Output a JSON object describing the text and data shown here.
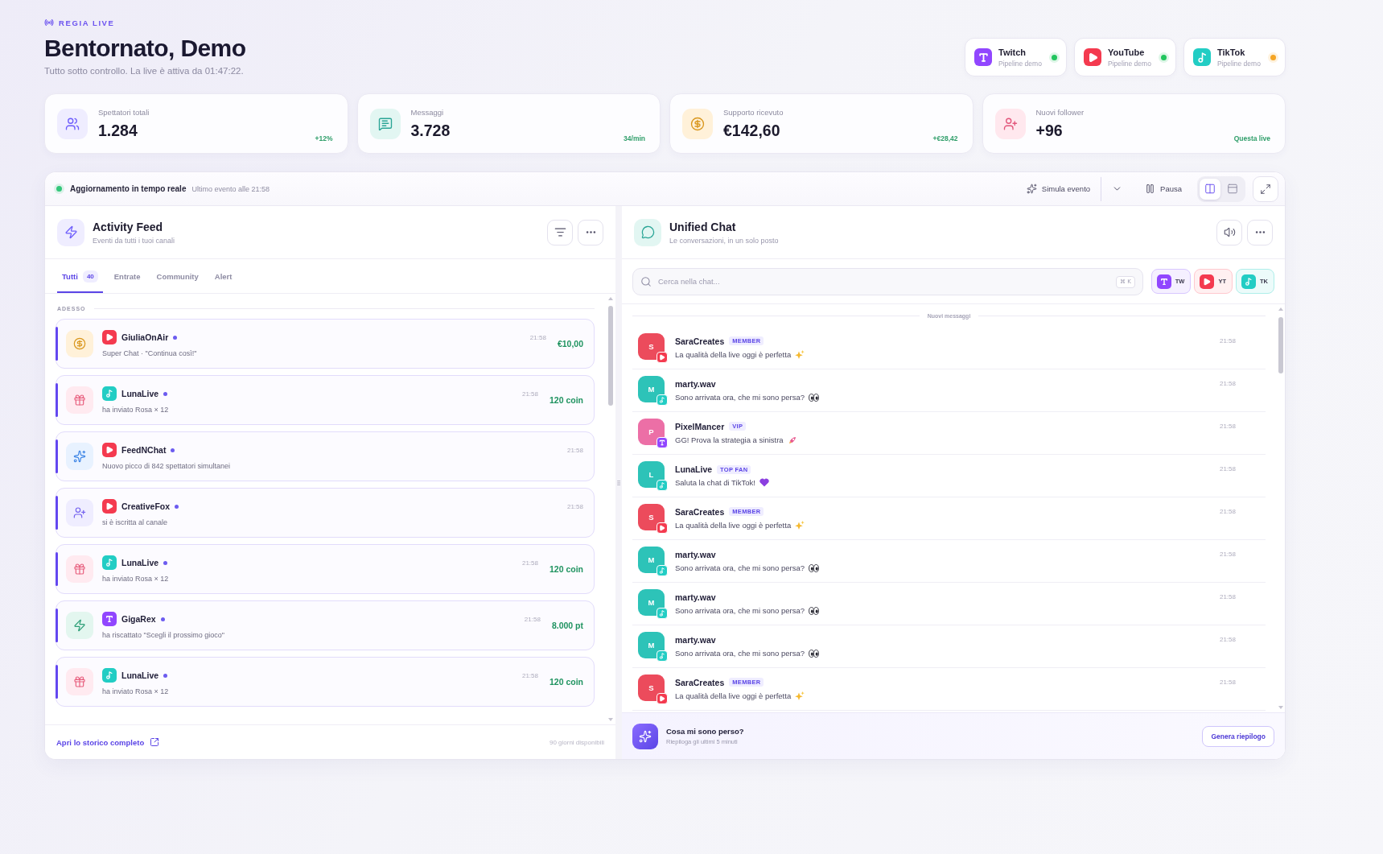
{
  "header": {
    "eyebrow": "REGIA LIVE",
    "title": "Bentornato, Demo",
    "subtitle": "Tutto sotto controllo. La live è attiva da 01:47:22."
  },
  "platforms": [
    {
      "kind": "twitch",
      "name": "Twitch",
      "status": "Pipeline demo",
      "color": "#22c55e"
    },
    {
      "kind": "youtube",
      "name": "YouTube",
      "status": "Pipeline demo",
      "color": "#22c55e"
    },
    {
      "kind": "tiktok",
      "name": "TikTok",
      "status": "Pipeline demo",
      "color": "#f5a524"
    }
  ],
  "stats": [
    {
      "kind": "viewers",
      "label": "Spettatori totali",
      "value": "1.284",
      "delta": "+12%"
    },
    {
      "kind": "messages",
      "label": "Messaggi",
      "value": "3.728",
      "delta": "34/min"
    },
    {
      "kind": "support",
      "label": "Supporto ricevuto",
      "value": "€142,60",
      "delta": "+€28,42"
    },
    {
      "kind": "followers",
      "label": "Nuovi follower",
      "value": "+96",
      "delta": "Questa live"
    }
  ],
  "toolbar": {
    "live": true,
    "status": "Aggiornamento in tempo reale",
    "last_event": "Ultimo evento alle 21:58",
    "simulate": "Simula evento",
    "pause": "Pausa",
    "views": [
      {
        "kind": "split",
        "selected": true
      },
      {
        "kind": "single",
        "selected": false
      }
    ]
  },
  "feed": {
    "title": "Activity Feed",
    "subtitle": "Eventi da tutti i tuoi canali",
    "tabs": [
      {
        "label": "Tutti",
        "count": "40",
        "selected": true
      },
      {
        "label": "Entrate",
        "selected": false
      },
      {
        "label": "Community",
        "selected": false
      },
      {
        "label": "Alert",
        "selected": false
      }
    ],
    "group": "ADESSO",
    "items": [
      {
        "kind": "support",
        "source": {
          "kind": "youtube"
        },
        "user": "GiuliaOnAir",
        "unread": true,
        "text": "Super Chat · \"Continua così!\"",
        "time": "21:58",
        "amount": "€10,00"
      },
      {
        "kind": "gift",
        "source": {
          "kind": "tiktok"
        },
        "user": "LunaLive",
        "unread": true,
        "text": "ha inviato Rosa × 12",
        "time": "21:58",
        "amount": "120 coin"
      },
      {
        "kind": "milestone",
        "source": {
          "kind": "youtube"
        },
        "user": "FeedNChat",
        "unread": true,
        "text": "Nuovo picco di 842 spettatori simultanei",
        "time": "21:58"
      },
      {
        "kind": "follow",
        "source": {
          "kind": "youtube"
        },
        "user": "CreativeFox",
        "unread": true,
        "text": "si è iscritta al canale",
        "time": "21:58"
      },
      {
        "kind": "gift",
        "source": {
          "kind": "tiktok"
        },
        "user": "LunaLive",
        "unread": true,
        "text": "ha inviato Rosa × 12",
        "time": "21:58",
        "amount": "120 coin"
      },
      {
        "kind": "redeem",
        "source": {
          "kind": "twitch"
        },
        "user": "GigaRex",
        "unread": true,
        "text": "ha riscattato \"Scegli il prossimo gioco\"",
        "time": "21:58",
        "amount": "8.000 pt"
      },
      {
        "kind": "gift",
        "source": {
          "kind": "tiktok"
        },
        "user": "LunaLive",
        "unread": true,
        "text": "ha inviato Rosa × 12",
        "time": "21:58",
        "amount": "120 coin"
      }
    ],
    "footer_link": "Apri lo storico completo",
    "footer_note": "90 giorni disponibili"
  },
  "chat": {
    "title": "Unified Chat",
    "subtitle": "Le conversazioni, in un solo posto",
    "search": {
      "placeholder": "Cerca nella chat...",
      "shortcut": "⌘ K"
    },
    "filters": [
      {
        "kind": "twitch",
        "label": "TW",
        "selected": true
      },
      {
        "kind": "youtube",
        "label": "YT",
        "selected": true
      },
      {
        "kind": "tiktok",
        "label": "TK",
        "selected": true
      }
    ],
    "divider": "Nuovi messaggi",
    "messages": [
      {
        "user": "SaraCreates",
        "initial": "S",
        "color": "#ec4b5c",
        "source": {
          "kind": "youtube"
        },
        "role": "MEMBER",
        "text": "La qualità della live oggi è perfetta",
        "emoji": {
          "kind": "sparkles"
        },
        "time": "21:58"
      },
      {
        "user": "marty.wav",
        "initial": "M",
        "color": "#2dc3b8",
        "source": {
          "kind": "tiktok"
        },
        "text": "Sono arrivata ora, che mi sono persa?",
        "emoji": {
          "kind": "eyes"
        },
        "time": "21:58"
      },
      {
        "user": "PixelMancer",
        "initial": "P",
        "color": "#ec6fa6",
        "source": {
          "kind": "twitch"
        },
        "role": "VIP",
        "text": "GG! Prova la strategia a sinistra",
        "emoji": {
          "kind": "rocket"
        },
        "time": "21:58"
      },
      {
        "user": "LunaLive",
        "initial": "L",
        "color": "#2dc3b8",
        "source": {
          "kind": "tiktok"
        },
        "role": "TOP FAN",
        "text": "Saluta la chat di TikTok!",
        "emoji": {
          "kind": "heart"
        },
        "time": "21:58"
      },
      {
        "user": "SaraCreates",
        "initial": "S",
        "color": "#ec4b5c",
        "source": {
          "kind": "youtube"
        },
        "role": "MEMBER",
        "text": "La qualità della live oggi è perfetta",
        "emoji": {
          "kind": "sparkles"
        },
        "time": "21:58"
      },
      {
        "user": "marty.wav",
        "initial": "M",
        "color": "#2dc3b8",
        "source": {
          "kind": "tiktok"
        },
        "text": "Sono arrivata ora, che mi sono persa?",
        "emoji": {
          "kind": "eyes"
        },
        "time": "21:58"
      },
      {
        "user": "marty.wav",
        "initial": "M",
        "color": "#2dc3b8",
        "source": {
          "kind": "tiktok"
        },
        "text": "Sono arrivata ora, che mi sono persa?",
        "emoji": {
          "kind": "eyes"
        },
        "time": "21:58"
      },
      {
        "user": "marty.wav",
        "initial": "M",
        "color": "#2dc3b8",
        "source": {
          "kind": "tiktok"
        },
        "text": "Sono arrivata ora, che mi sono persa?",
        "emoji": {
          "kind": "eyes"
        },
        "time": "21:58"
      },
      {
        "user": "SaraCreates",
        "initial": "S",
        "color": "#ec4b5c",
        "source": {
          "kind": "youtube"
        },
        "role": "MEMBER",
        "text": "La qualità della live oggi è perfetta",
        "emoji": {
          "kind": "sparkles"
        },
        "time": "21:58"
      }
    ],
    "summary": {
      "title": "Cosa mi sono perso?",
      "subtitle": "Riepiloga gli ultimi 5 minuti",
      "button": "Genera riepilogo"
    }
  }
}
